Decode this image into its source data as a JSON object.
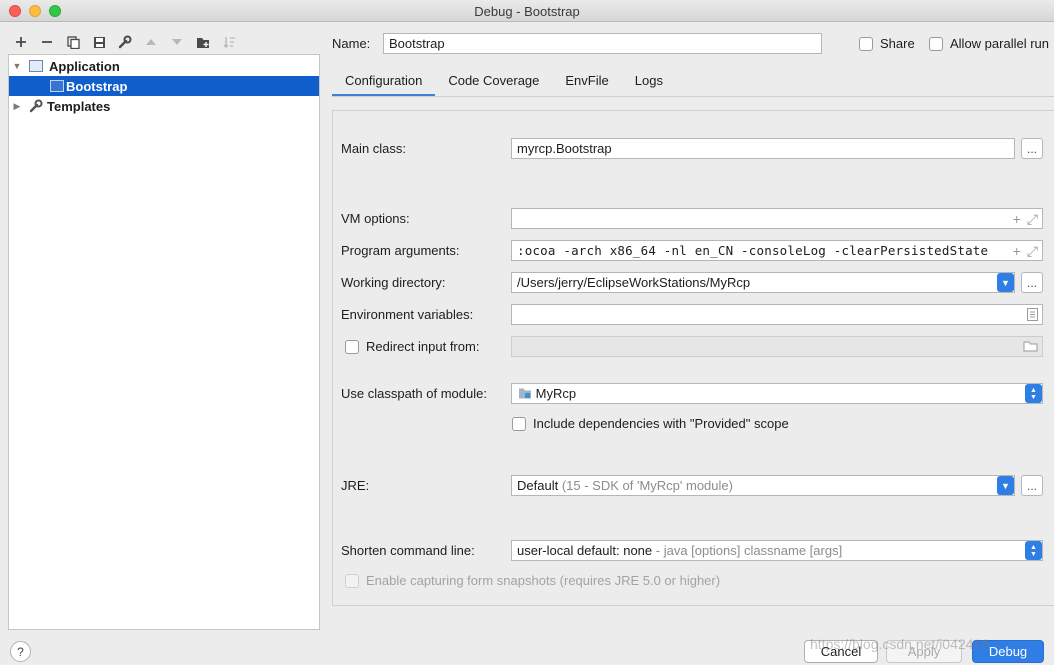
{
  "window": {
    "title": "Debug - Bootstrap"
  },
  "toolbar": {
    "icons": [
      "add-icon",
      "remove-icon",
      "copy-icon",
      "save-icon",
      "wrench-icon",
      "move-up-icon",
      "move-down-icon",
      "folder-add-icon",
      "sort-icon"
    ]
  },
  "tree": {
    "application": "Application",
    "bootstrap": "Bootstrap",
    "templates": "Templates"
  },
  "header": {
    "name_label": "Name:",
    "name_value": "Bootstrap",
    "share_label": "Share",
    "parallel_label": "Allow parallel run"
  },
  "tabs": [
    "Configuration",
    "Code Coverage",
    "EnvFile",
    "Logs"
  ],
  "form": {
    "main_class_label": "Main class:",
    "main_class_value": "myrcp.Bootstrap",
    "browse_label": "...",
    "vm_options_label": "VM options:",
    "vm_options_value": "",
    "program_args_label": "Program arguments:",
    "program_args_value": ":ocoa -arch x86_64 -nl en_CN -consoleLog -clearPersistedState",
    "working_dir_label": "Working directory:",
    "working_dir_value": "/Users/jerry/EclipseWorkStations/MyRcp",
    "env_vars_label": "Environment variables:",
    "env_vars_value": "",
    "redirect_label": "Redirect input from:",
    "classpath_label": "Use classpath of module:",
    "classpath_value": "MyRcp",
    "include_deps_label": "Include dependencies with \"Provided\" scope",
    "jre_label": "JRE:",
    "jre_value": "Default",
    "jre_hint": "(15 - SDK of 'MyRcp' module)",
    "shorten_label": "Shorten command line:",
    "shorten_value": "user-local default: none",
    "shorten_hint": "- java [options] classname [args]",
    "snapshots_label": "Enable capturing form snapshots (requires JRE 5.0 or higher)"
  },
  "footer": {
    "help_label": "?",
    "cancel_label": "Cancel",
    "apply_label": "Apply",
    "debug_label": "Debug",
    "watermark": "https://blog.csdn.net/i042416"
  },
  "colors": {
    "accent": "#2f7ee6",
    "selection": "#0f5ecb"
  }
}
